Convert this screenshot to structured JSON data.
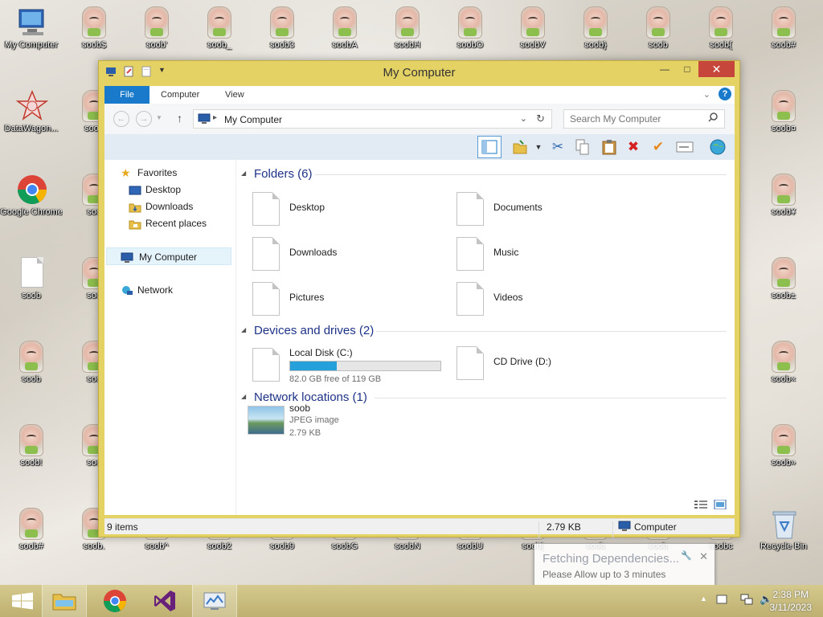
{
  "desktop": {
    "icons": [
      {
        "label": "My Computer",
        "kind": "computer-icon"
      },
      {
        "label": "soob$",
        "kind": "gnome-image-icon"
      },
      {
        "label": "soob'",
        "kind": "gnome-image-icon"
      },
      {
        "label": "soob_",
        "kind": "gnome-image-icon"
      },
      {
        "label": "soob3",
        "kind": "gnome-image-icon"
      },
      {
        "label": "soobA",
        "kind": "gnome-image-icon"
      },
      {
        "label": "soobH",
        "kind": "gnome-image-icon"
      },
      {
        "label": "soobO",
        "kind": "gnome-image-icon"
      },
      {
        "label": "soobV",
        "kind": "gnome-image-icon"
      },
      {
        "label": "soob}",
        "kind": "gnome-image-icon"
      },
      {
        "label": "soob",
        "kind": "gnome-image-icon"
      },
      {
        "label": "soob{",
        "kind": "gnome-image-icon"
      },
      {
        "label": "soob#",
        "kind": "gnome-image-icon"
      },
      {
        "label": "DataWagon...",
        "kind": "datawagon-icon"
      },
      {
        "label": "soob",
        "kind": "gnome-image-icon"
      },
      {
        "label": "soob¤",
        "kind": "gnome-image-icon"
      },
      {
        "label": "Google Chrome",
        "kind": "chrome-icon"
      },
      {
        "label": "soo",
        "kind": "gnome-image-icon"
      },
      {
        "label": "soob¥",
        "kind": "gnome-image-icon"
      },
      {
        "label": "soob",
        "kind": "blank-file-icon"
      },
      {
        "label": "soo",
        "kind": "gnome-image-icon"
      },
      {
        "label": "soob±",
        "kind": "gnome-image-icon"
      },
      {
        "label": "soob",
        "kind": "gnome-image-icon"
      },
      {
        "label": "soo",
        "kind": "gnome-image-icon"
      },
      {
        "label": "soob«",
        "kind": "gnome-image-icon"
      },
      {
        "label": "soob!",
        "kind": "gnome-image-icon"
      },
      {
        "label": "soo",
        "kind": "gnome-image-icon"
      },
      {
        "label": "soob»",
        "kind": "gnome-image-icon"
      },
      {
        "label": "soob#",
        "kind": "gnome-image-icon"
      },
      {
        "label": "soob.",
        "kind": "gnome-image-icon"
      },
      {
        "label": "soob^",
        "kind": "gnome-image-icon"
      },
      {
        "label": "soob2",
        "kind": "gnome-image-icon"
      },
      {
        "label": "soob9",
        "kind": "gnome-image-icon"
      },
      {
        "label": "soobG",
        "kind": "gnome-image-icon"
      },
      {
        "label": "soobN",
        "kind": "gnome-image-icon"
      },
      {
        "label": "soobU",
        "kind": "gnome-image-icon"
      },
      {
        "label": "soob|",
        "kind": "gnome-image-icon"
      },
      {
        "label": "soob",
        "kind": "gnome-image-icon"
      },
      {
        "label": "soob",
        "kind": "gnome-image-icon"
      },
      {
        "label": "soobc",
        "kind": "gnome-image-icon"
      },
      {
        "label": "Recycle Bin",
        "kind": "recycle-bin-icon"
      }
    ]
  },
  "window": {
    "title": "My Computer",
    "ribbon_tabs": [
      "File",
      "Computer",
      "View"
    ],
    "address": "My Computer",
    "search_placeholder": "Search My Computer",
    "nav": {
      "favorites": "Favorites",
      "desktop": "Desktop",
      "downloads": "Downloads",
      "recent": "Recent places",
      "mycomputer": "My Computer",
      "network": "Network"
    },
    "groups": {
      "folders": "Folders (6)",
      "devices": "Devices and drives (2)",
      "network": "Network locations (1)"
    },
    "folders": [
      "Desktop",
      "Documents",
      "Downloads",
      "Music",
      "Pictures",
      "Videos"
    ],
    "drives": {
      "local": {
        "name": "Local Disk (C:)",
        "free": "82.0 GB free of 119 GB",
        "used_fraction": 0.31
      },
      "cd": {
        "name": "CD Drive (D:)"
      }
    },
    "network_item": {
      "name": "soob",
      "type": "JPEG image",
      "size": "2.79 KB"
    },
    "status": {
      "items": "9 items",
      "size": "2.79 KB",
      "location": "Computer"
    }
  },
  "notification": {
    "title": "Fetching Dependencies...",
    "message": "Please Allow up to 3 minutes"
  },
  "taskbar": {
    "time": "2:38 PM",
    "date": "3/11/2023"
  },
  "colors": {
    "accent": "#1979ca",
    "window_frame": "#e5d264",
    "drive_bar": "#26a0da",
    "group_title": "#1e3287"
  }
}
